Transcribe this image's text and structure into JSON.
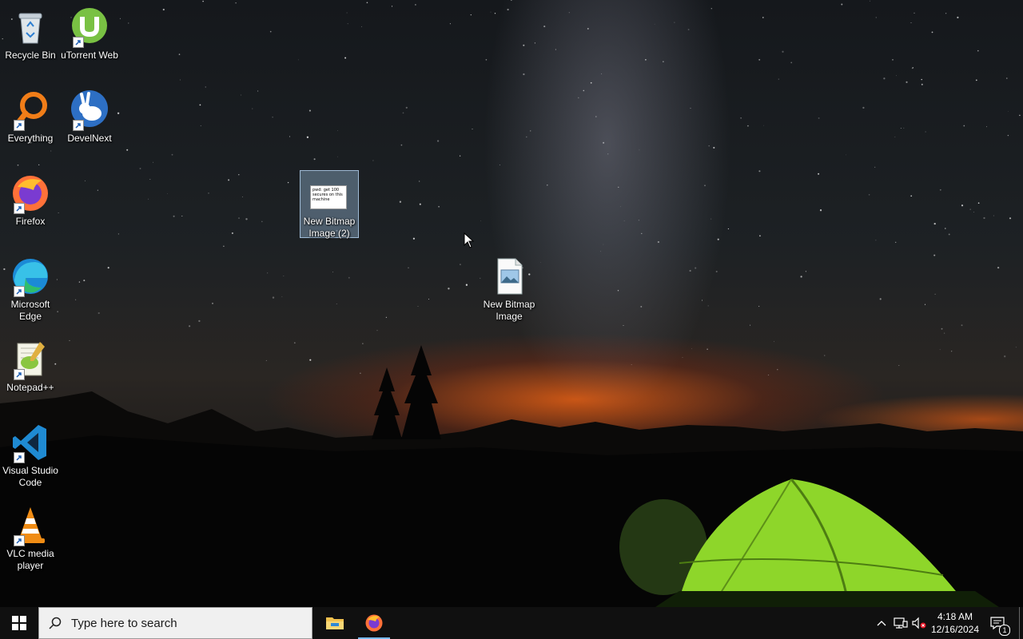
{
  "desktop": {
    "icons": [
      {
        "label": "Recycle Bin",
        "icon": "recycle-bin-icon"
      },
      {
        "label": "uTorrent Web",
        "icon": "utorrent-icon"
      },
      {
        "label": "Everything",
        "icon": "everything-search-icon"
      },
      {
        "label": "DevelNext",
        "icon": "develnext-rabbit-icon"
      },
      {
        "label": "Firefox",
        "icon": "firefox-icon"
      },
      {
        "label": "Microsoft Edge",
        "icon": "edge-icon"
      },
      {
        "label": "Notepad++",
        "icon": "notepadpp-icon"
      },
      {
        "label": "Visual Studio Code",
        "icon": "vscode-icon"
      },
      {
        "label": "VLC media player",
        "icon": "vlc-icon"
      },
      {
        "label": "New Bitmap Image (2)",
        "icon": "bitmap-thumbnail-icon",
        "selected": true,
        "thumbnail_text": "pwd: get 100 secures on this machine"
      },
      {
        "label": "New Bitmap Image",
        "icon": "bitmap-file-icon"
      }
    ]
  },
  "taskbar": {
    "search_placeholder": "Type here to search",
    "pinned": [
      {
        "name": "File Explorer",
        "icon": "file-explorer-icon"
      },
      {
        "name": "Firefox",
        "icon": "firefox-icon",
        "active": true
      }
    ],
    "tray": {
      "icons": [
        "chevron-up-icon",
        "network-icon",
        "volume-muted-icon"
      ],
      "time": "4:18 AM",
      "date": "12/16/2024",
      "notification_count": "1"
    }
  },
  "colors": {
    "taskbar": "#101010",
    "search_bg": "#f0f0f0",
    "accent": "#76b9ed",
    "tent": "#8ed62a"
  }
}
